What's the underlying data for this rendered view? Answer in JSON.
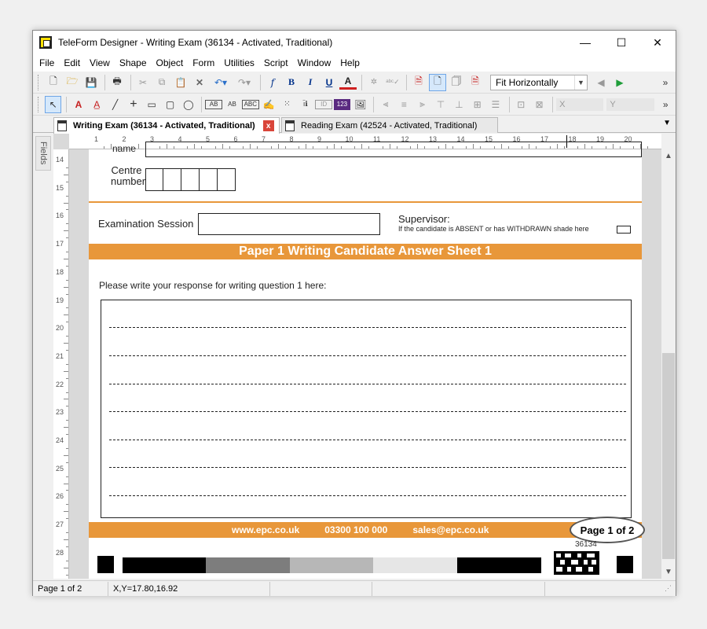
{
  "window": {
    "title": "TeleForm Designer - Writing Exam (36134 - Activated, Traditional)",
    "min_glyph": "—",
    "max_glyph": "☐",
    "close_glyph": "✕"
  },
  "menu": [
    "File",
    "Edit",
    "View",
    "Shape",
    "Object",
    "Form",
    "Utilities",
    "Script",
    "Window",
    "Help"
  ],
  "toolbar1": {
    "zoom_value": "Fit Horizontally",
    "overflow": "»"
  },
  "toolbar2": {
    "x_label": "X",
    "y_label": "Y",
    "overflow": "»"
  },
  "tabs": [
    {
      "label": "Writing Exam (36134 - Activated, Traditional)",
      "close": "x"
    },
    {
      "label": "Reading Exam (42524 - Activated, Traditional)"
    }
  ],
  "side_panel": "Fields",
  "ruler": {
    "top": [
      "1",
      "2",
      "3",
      "4",
      "5",
      "6",
      "7",
      "8",
      "9",
      "10",
      "11",
      "12",
      "13",
      "14",
      "15",
      "16",
      "17",
      "18",
      "19",
      "20"
    ],
    "left": [
      "14",
      "15",
      "16",
      "17",
      "18",
      "19",
      "20",
      "21",
      "22",
      "23",
      "24",
      "25",
      "26",
      "27",
      "28"
    ]
  },
  "form": {
    "name_label_fragment": "name",
    "centre_label_line1": "Centre",
    "centre_label_line2": "number",
    "exam_session_label": "Examination Session",
    "supervisor_label": "Supervisor:",
    "supervisor_note": "If the candidate is ABSENT or has WITHDRAWN shade here",
    "banner_title": "Paper 1 Writing Candidate Answer Sheet 1",
    "prompt": "Please write your response for writing question 1 here:",
    "footer_web": "www.epc.co.uk",
    "footer_phone": "03300 100 000",
    "footer_email": "sales@epc.co.uk",
    "page_badge": "Page 1 of 2",
    "form_id": "36134"
  },
  "status": {
    "page": "Page 1 of 2",
    "coords": "X,Y=17.80,16.92"
  },
  "colors": {
    "accent_orange": "#e8973a"
  }
}
